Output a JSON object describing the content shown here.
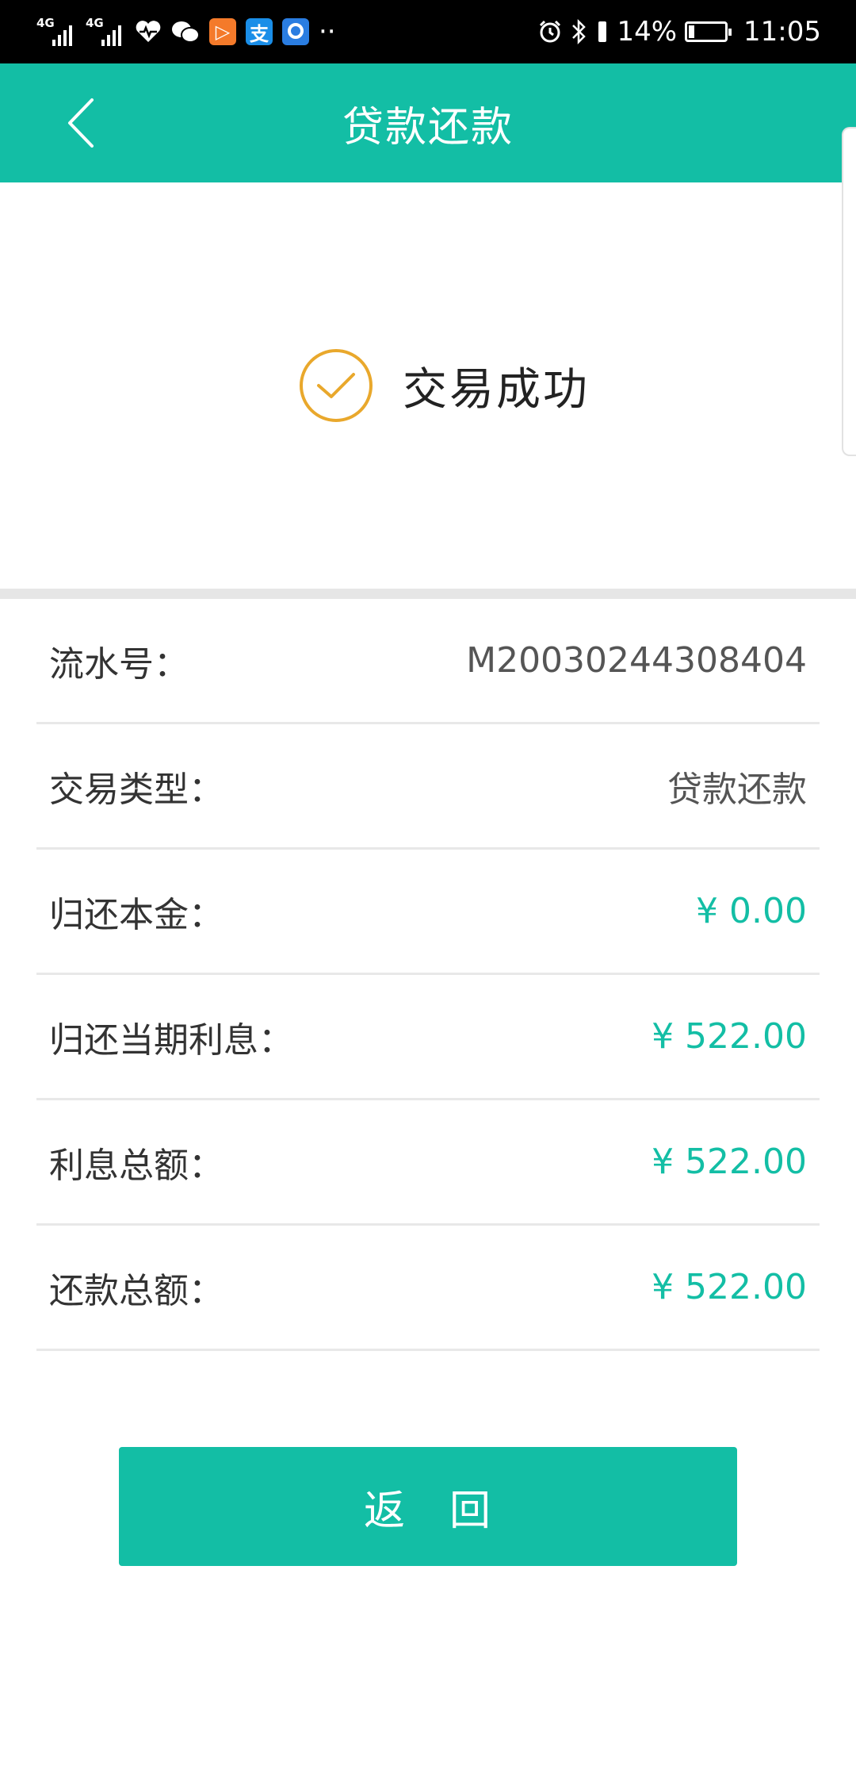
{
  "status_bar": {
    "network_1": "4G",
    "network_2": "4G",
    "battery_percent": "14%",
    "time": "11:05",
    "overflow": "··",
    "icons": [
      "health-icon",
      "wechat-icon",
      "video-app-icon",
      "alipay-icon",
      "app-icon",
      "alarm-icon",
      "bluetooth-icon",
      "vibrate-icon",
      "battery-icon"
    ]
  },
  "header": {
    "title": "贷款还款",
    "back_icon": "chevron-left-icon"
  },
  "result": {
    "status_text": "交易成功",
    "icon": "check-circle-icon",
    "icon_color": "#e9a82c"
  },
  "details": [
    {
      "label": "流水号：",
      "value": "M20030244308404",
      "money": false
    },
    {
      "label": "交易类型：",
      "value": "贷款还款",
      "money": false
    },
    {
      "label": "归还本金：",
      "value": "¥ 0.00",
      "money": true
    },
    {
      "label": "归还当期利息：",
      "value": "¥ 522.00",
      "money": true
    },
    {
      "label": "利息总额：",
      "value": "¥ 522.00",
      "money": true
    },
    {
      "label": "还款总额：",
      "value": "¥ 522.00",
      "money": true
    }
  ],
  "actions": {
    "return_label": "返　回"
  },
  "colors": {
    "accent": "#13bea5",
    "success_icon": "#e9a82c",
    "status_bar": "#000000"
  }
}
